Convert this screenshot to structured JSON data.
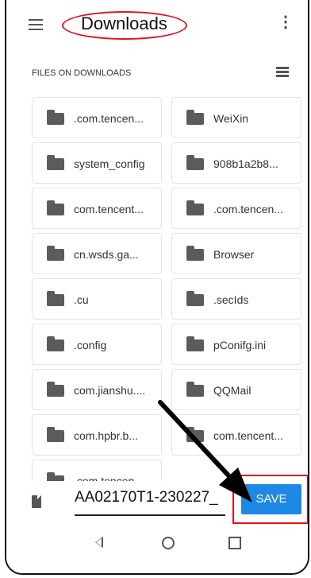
{
  "header": {
    "title": "Downloads"
  },
  "section_title": "FILES ON DOWNLOADS",
  "files": [
    ".com.tencen...",
    "WeiXin",
    "system_config",
    "908b1a2b8...",
    "com.tencent...",
    ".com.tencen...",
    "cn.wsds.ga...",
    "Browser",
    ".cu",
    ".secIds",
    ".config",
    "pConifg.ini",
    "com.jianshu....",
    "QQMail",
    "com.hpbr.b...",
    "com.tencent...",
    ".com.tencen..."
  ],
  "bottom": {
    "filename": "AA02170T1-230227_",
    "save_label": "SAVE"
  },
  "icons": {
    "menu": "hamburger-icon",
    "overflow": "more-vert-icon",
    "view_toggle": "list-view-icon",
    "file": "file-icon"
  }
}
